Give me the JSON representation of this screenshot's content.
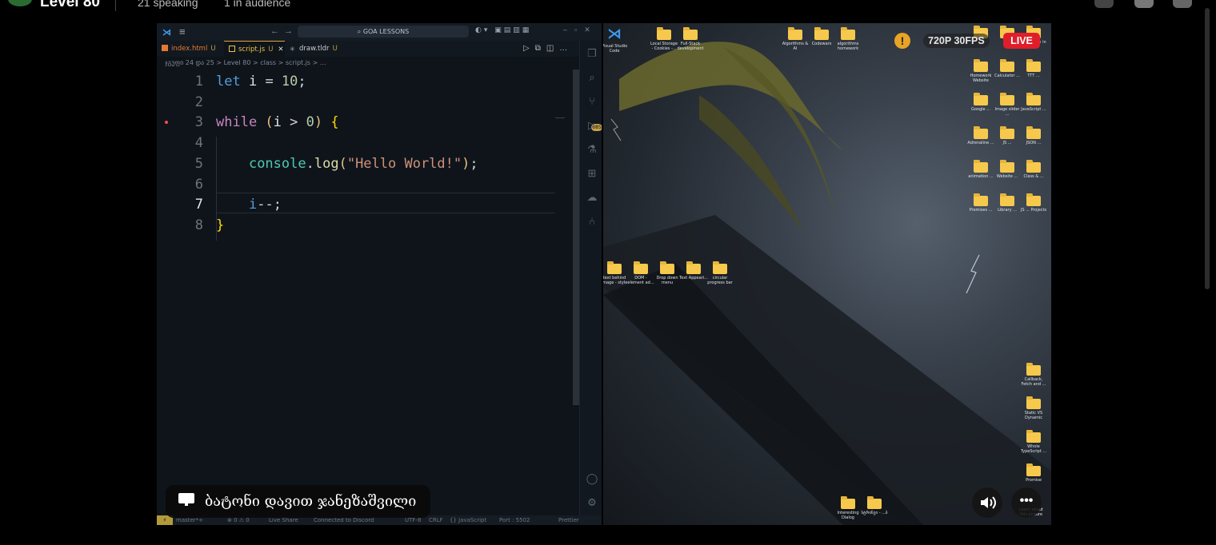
{
  "topbar": {
    "room_title": "Level 80",
    "speaking": "21 speaking",
    "audience": "1 in audience"
  },
  "vscode": {
    "search_text": "GOA LESSONS",
    "tabs": [
      {
        "label": "index.html",
        "status": "U",
        "color": "#e37933"
      },
      {
        "label": "script.js",
        "status": "U",
        "color": "#e8c545",
        "active": true,
        "close": "✕"
      },
      {
        "label": "draw.tldr",
        "status": "U",
        "color": "#cccccc"
      }
    ],
    "breadcrumb": "ჯგუფი 24 და 25 > Level 80 > class > script.js > ...",
    "code": [
      {
        "n": "1",
        "tokens": [
          [
            "kw",
            "let"
          ],
          [
            "var",
            " i "
          ],
          [
            "op",
            "= "
          ],
          [
            "num",
            "10"
          ],
          [
            "pun",
            ";"
          ]
        ]
      },
      {
        "n": "2",
        "tokens": []
      },
      {
        "n": "3",
        "tokens": [
          [
            "ctrl",
            "while "
          ],
          [
            "paren",
            "("
          ],
          [
            "var",
            "i "
          ],
          [
            "op",
            "> "
          ],
          [
            "num",
            "0"
          ],
          [
            "paren",
            ")"
          ],
          [
            "brace",
            " {"
          ]
        ]
      },
      {
        "n": "4",
        "tokens": []
      },
      {
        "n": "5",
        "tokens": [
          [
            "var",
            "    "
          ],
          [
            "obj",
            "console"
          ],
          [
            "pun",
            "."
          ],
          [
            "fn",
            "log"
          ],
          [
            "paren",
            "("
          ],
          [
            "str",
            "\"Hello World!\""
          ],
          [
            "paren",
            ")"
          ],
          [
            "pun",
            ";"
          ]
        ]
      },
      {
        "n": "6",
        "tokens": []
      },
      {
        "n": "7",
        "tokens": [
          [
            "var",
            "    "
          ],
          [
            "kw",
            "i"
          ],
          [
            "op",
            "--"
          ],
          [
            "pun",
            ";"
          ]
        ]
      },
      {
        "n": "8",
        "tokens": [
          [
            "brace",
            "}"
          ]
        ]
      }
    ],
    "active_line": "7",
    "activity_badge": "685",
    "status": {
      "branch": "master*+",
      "problems": "⊗ 0 ⚠ 0",
      "live_share": "Live Share",
      "discord": "Connected to Discord",
      "encoding": "UTF-8",
      "eol": "CRLF",
      "language": "{} JavaScript",
      "port": "Port : 5502",
      "prettier": "Prettier"
    }
  },
  "desktop": {
    "top_icons": [
      {
        "label": "Visual Studio Code"
      },
      {
        "label": "Local Storage - Cookies -..."
      },
      {
        "label": "Full-Stack development"
      },
      {
        "label": "Algorithms & AI"
      },
      {
        "label": "Codewars"
      },
      {
        "label": "algorithms homework"
      }
    ],
    "right_icons": [
      {
        "label": "...",
        "row": 0
      },
      {
        "label": "...",
        "row": 0
      },
      {
        "label": "animation in css",
        "row": 0
      },
      {
        "label": "Homework Website",
        "row": 1
      },
      {
        "label": "Calculator ...",
        "row": 1
      },
      {
        "label": "TTT ...",
        "row": 1
      },
      {
        "label": "Google ...",
        "row": 2
      },
      {
        "label": "Image slider ...",
        "row": 2
      },
      {
        "label": "JavaScript ...",
        "row": 2
      },
      {
        "label": "Adrenaline ...",
        "row": 3
      },
      {
        "label": "JS ...",
        "row": 3
      },
      {
        "label": "JSON ...",
        "row": 3
      },
      {
        "label": "animation ...",
        "row": 4
      },
      {
        "label": "Website ...",
        "row": 4
      },
      {
        "label": "Class & ...",
        "row": 4
      },
      {
        "label": "Promises ...",
        "row": 5
      },
      {
        "label": "Library ...",
        "row": 5
      },
      {
        "label": "JS ... Projects",
        "row": 5
      }
    ],
    "mid_icons": [
      {
        "label": "text behind image - style"
      },
      {
        "label": "DOM - element ad..."
      },
      {
        "label": "Drop down menu"
      },
      {
        "label": "Text Appeari..."
      },
      {
        "label": "circular progress bar"
      }
    ],
    "bottom_right_icons": [
      {
        "label": "Callback, Fetch and ..."
      },
      {
        "label": "Static VS Dynamic"
      },
      {
        "label": "Whole TypeScript ..."
      },
      {
        "label": "Promise"
      }
    ],
    "bottom_icons": [
      {
        "label": "Interesting Dialog"
      },
      {
        "label": "სტრინგი - ...ბ"
      }
    ],
    "learn_about": "Learn about this picture"
  },
  "overlay": {
    "warning_icon": "!",
    "quality": "720P 30FPS",
    "live": "LIVE",
    "more": "•••",
    "presenter_name": "ბატონი დავით ჯანეზაშვილი"
  },
  "colors": {
    "live_red": "#e01e2a",
    "warning": "#e8a425",
    "folder": "#f6c94c"
  }
}
